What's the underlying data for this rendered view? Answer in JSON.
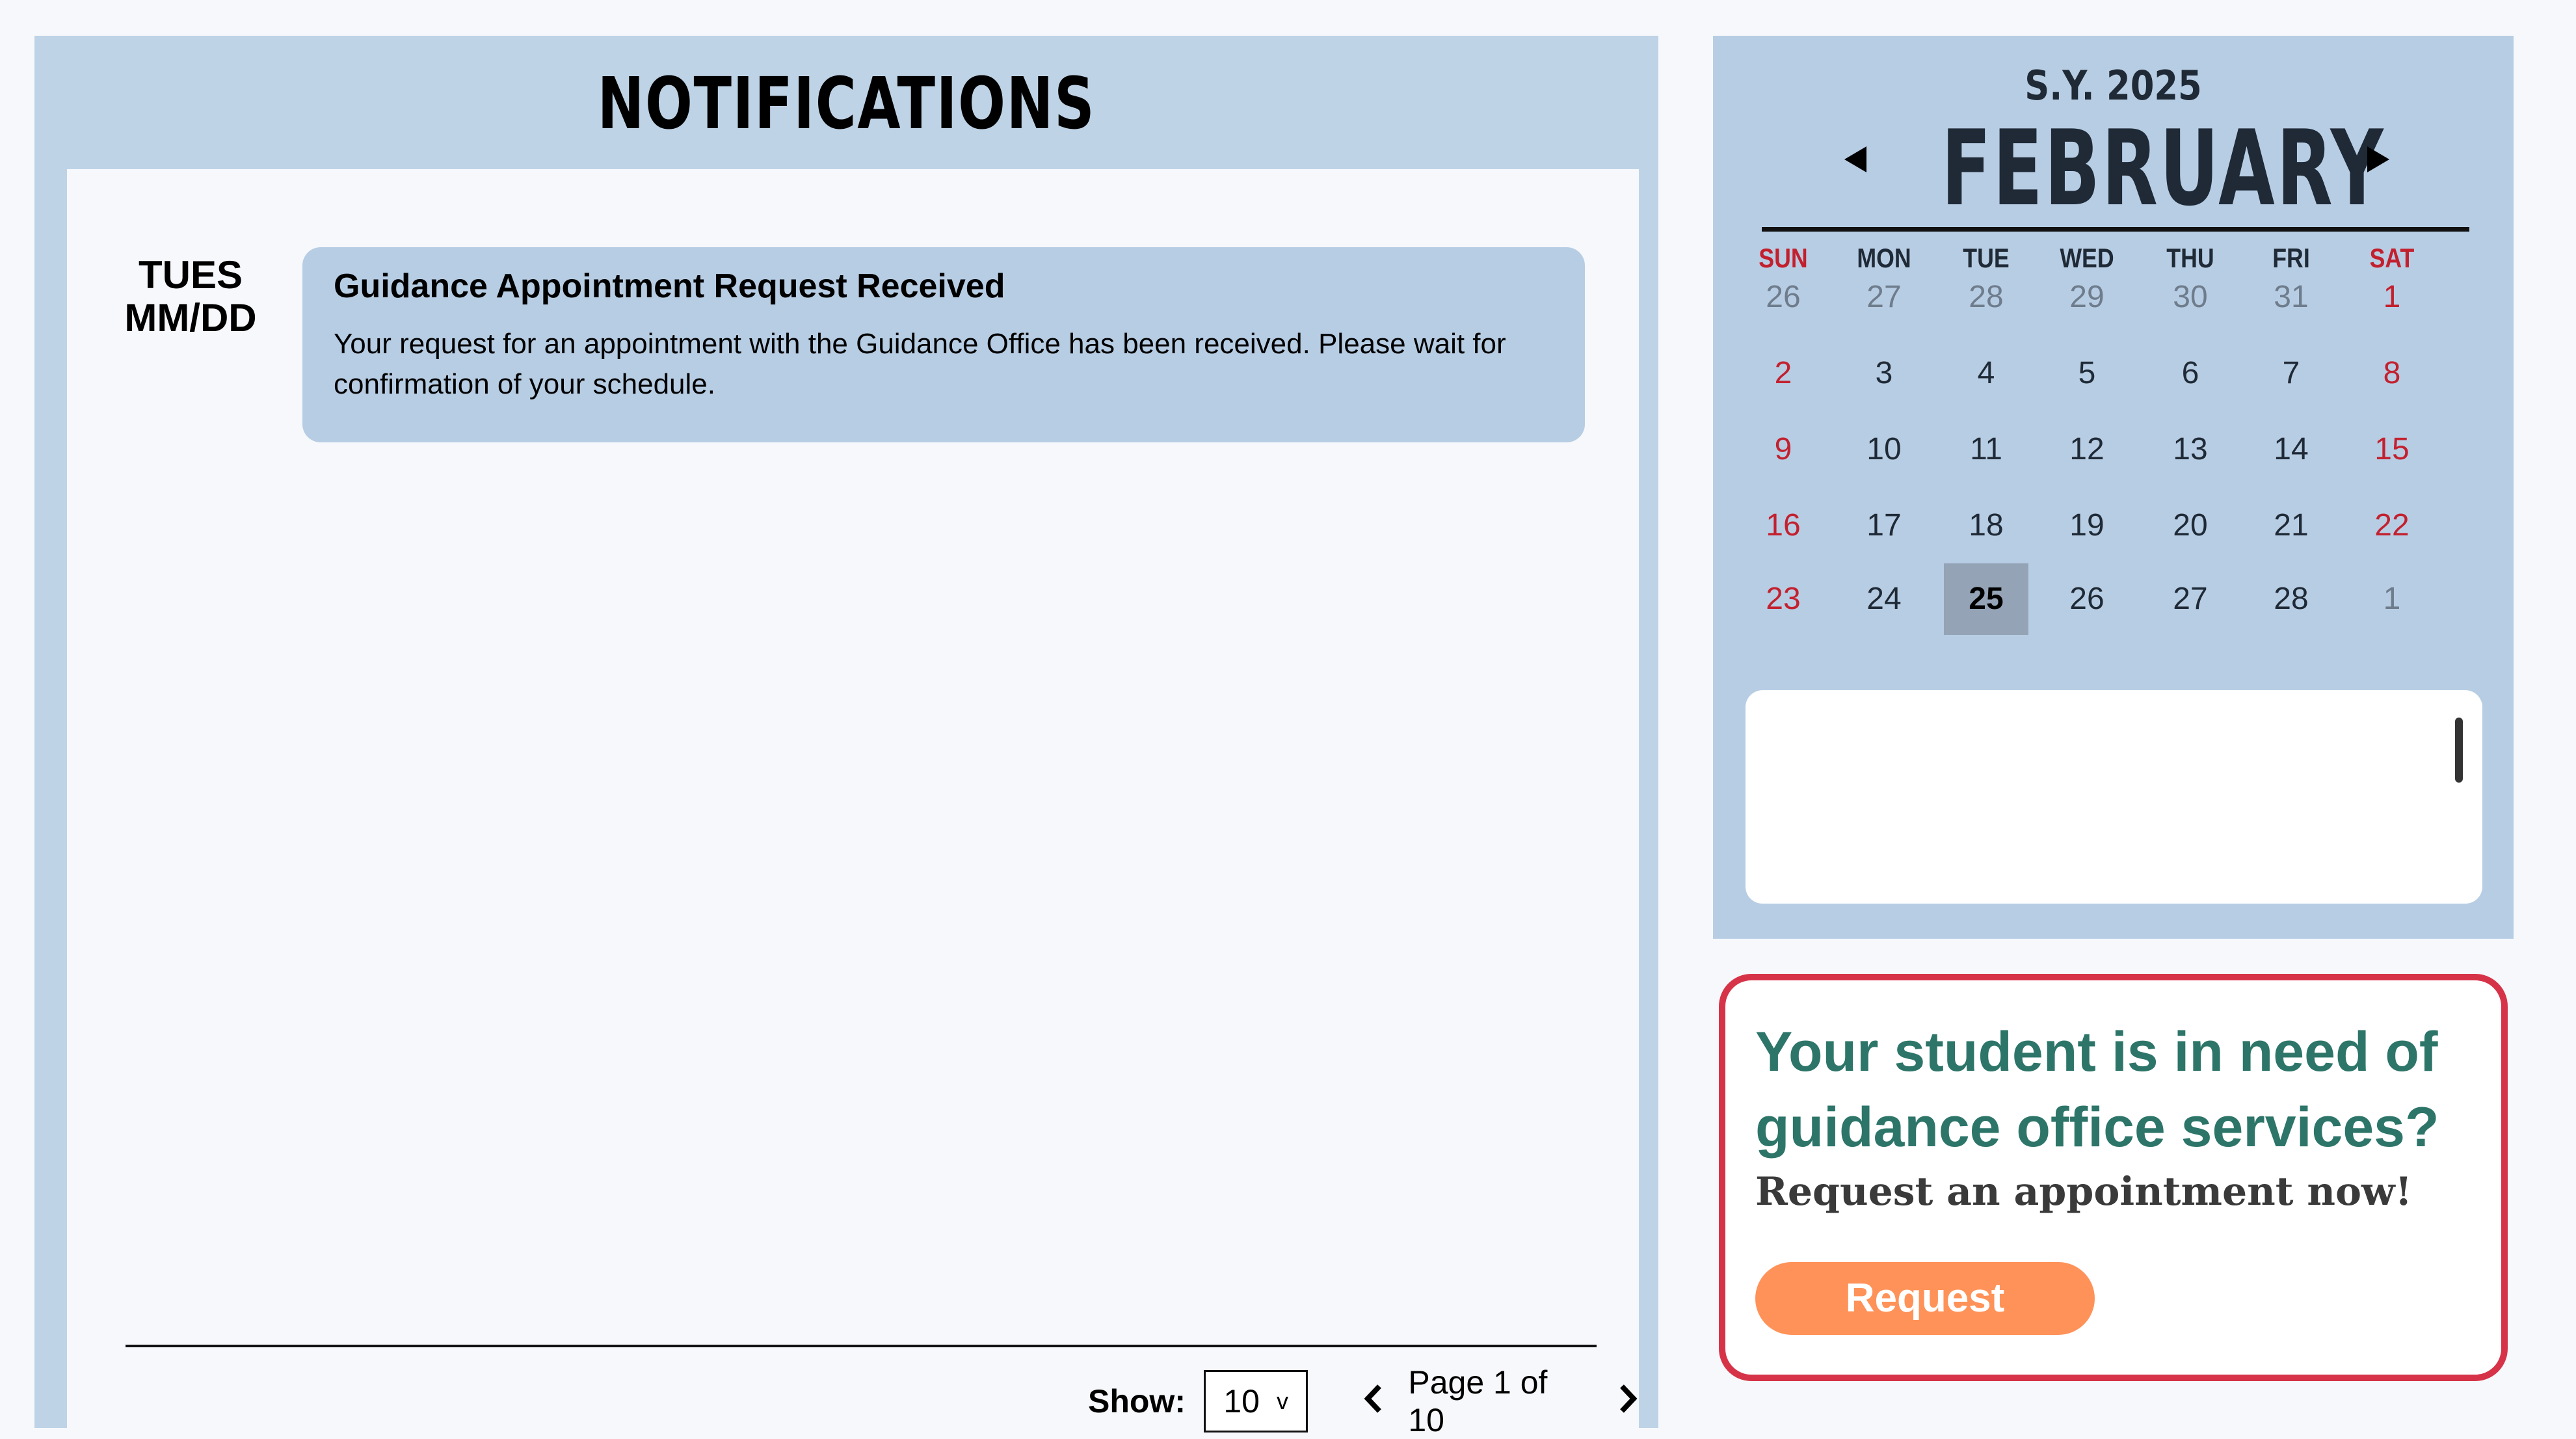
{
  "notifications": {
    "title": "NOTIFICATIONS",
    "date_line1": "TUES",
    "date_line2": "MM/DD",
    "items": [
      {
        "title": "Guidance Appointment Request Received",
        "text": "Your request for an appointment with the Guidance Office has been received. Please wait for confirmation of your schedule."
      }
    ],
    "show_label": "Show:",
    "show_value": "10",
    "show_caret": "v",
    "page_text": "Page 1 of 10",
    "prev_icon": "chevron-left",
    "next_icon": "chevron-right"
  },
  "calendar": {
    "school_year": "S.Y. 2025",
    "month": "FEBRUARY",
    "weekdays": [
      "SUN",
      "MON",
      "TUE",
      "WED",
      "THU",
      "FRI",
      "SAT"
    ],
    "weeks": [
      [
        "26",
        "27",
        "28",
        "29",
        "30",
        "31",
        "1"
      ],
      [
        "2",
        "3",
        "4",
        "5",
        "6",
        "7",
        "8"
      ],
      [
        "9",
        "10",
        "11",
        "12",
        "13",
        "14",
        "15"
      ],
      [
        "16",
        "17",
        "18",
        "19",
        "20",
        "21",
        "22"
      ],
      [
        "23",
        "24",
        "25",
        "26",
        "27",
        "28",
        "1"
      ]
    ],
    "today": "25",
    "weekend_color": "#c3202e",
    "today_bg": "#94a3b6"
  },
  "cta": {
    "heading": "Your student is in need of guidance office services?",
    "subheading": "Request an appointment now!",
    "button_label": "Request",
    "accent": "#d63348",
    "heading_color": "#2d7569",
    "button_color": "#ff9258"
  }
}
